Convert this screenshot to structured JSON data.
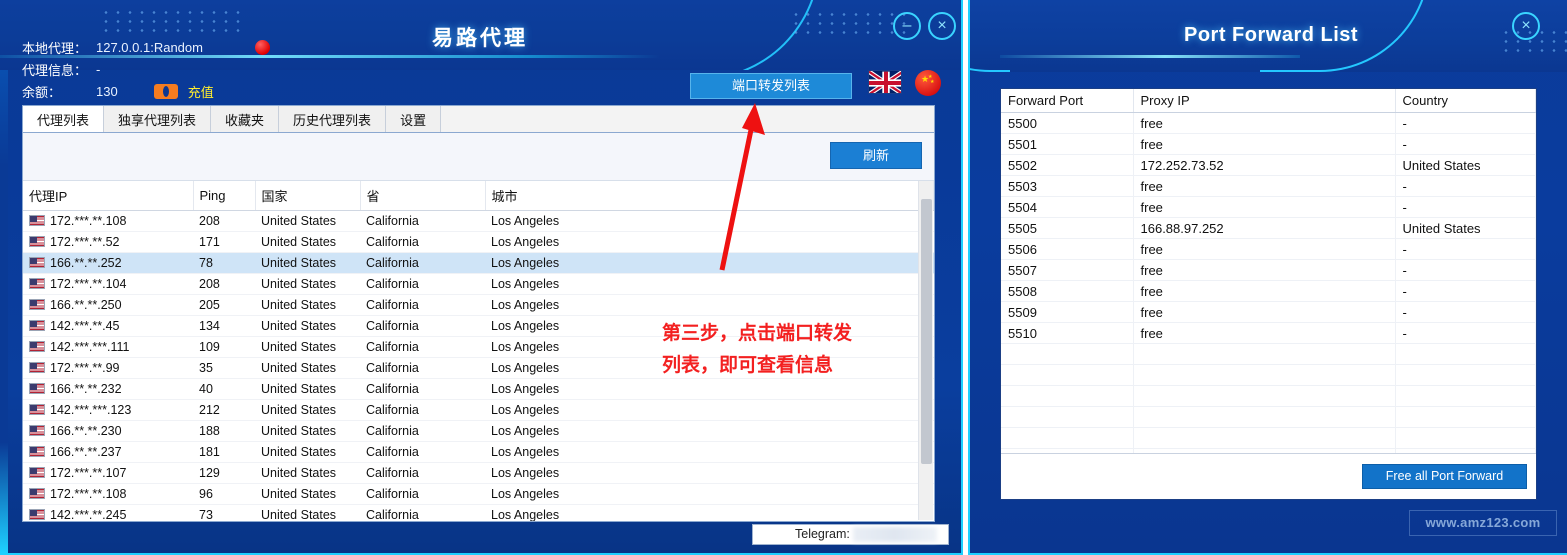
{
  "left_window": {
    "title": "易路代理",
    "controls": {
      "minimize": "–",
      "close": "×"
    },
    "info": {
      "local_proxy_label": "本地代理：",
      "local_proxy_value": "127.0.0.1:Random",
      "proxy_info_label": "代理信息：",
      "proxy_info_value": "-",
      "balance_label": "余额：",
      "balance_value": "130",
      "recharge_label": "充值"
    },
    "port_forward_button": "端口转发列表",
    "flags": {
      "uk": "uk-flag-icon",
      "cn": "cn-flag-icon"
    },
    "tabs": [
      {
        "label": "代理列表",
        "active": true
      },
      {
        "label": "独享代理列表",
        "active": false
      },
      {
        "label": "收藏夹",
        "active": false
      },
      {
        "label": "历史代理列表",
        "active": false
      },
      {
        "label": "设置",
        "active": false
      }
    ],
    "refresh_button": "刷新",
    "table": {
      "columns": [
        "代理IP",
        "Ping",
        "国家",
        "省",
        "城市"
      ],
      "rows": [
        {
          "ip": "172.***.**.108",
          "ping": "208",
          "country": "United States",
          "province": "California",
          "city": "Los Angeles",
          "selected": false
        },
        {
          "ip": "172.***.**.52",
          "ping": "171",
          "country": "United States",
          "province": "California",
          "city": "Los Angeles",
          "selected": false
        },
        {
          "ip": "166.**.**.252",
          "ping": "78",
          "country": "United States",
          "province": "California",
          "city": "Los Angeles",
          "selected": true
        },
        {
          "ip": "172.***.**.104",
          "ping": "208",
          "country": "United States",
          "province": "California",
          "city": "Los Angeles",
          "selected": false
        },
        {
          "ip": "166.**.**.250",
          "ping": "205",
          "country": "United States",
          "province": "California",
          "city": "Los Angeles",
          "selected": false
        },
        {
          "ip": "142.***.**.45",
          "ping": "134",
          "country": "United States",
          "province": "California",
          "city": "Los Angeles",
          "selected": false
        },
        {
          "ip": "142.***.***.111",
          "ping": "109",
          "country": "United States",
          "province": "California",
          "city": "Los Angeles",
          "selected": false
        },
        {
          "ip": "172.***.**.99",
          "ping": "35",
          "country": "United States",
          "province": "California",
          "city": "Los Angeles",
          "selected": false
        },
        {
          "ip": "166.**.**.232",
          "ping": "40",
          "country": "United States",
          "province": "California",
          "city": "Los Angeles",
          "selected": false
        },
        {
          "ip": "142.***.***.123",
          "ping": "212",
          "country": "United States",
          "province": "California",
          "city": "Los Angeles",
          "selected": false
        },
        {
          "ip": "166.**.**.230",
          "ping": "188",
          "country": "United States",
          "province": "California",
          "city": "Los Angeles",
          "selected": false
        },
        {
          "ip": "166.**.**.237",
          "ping": "181",
          "country": "United States",
          "province": "California",
          "city": "Los Angeles",
          "selected": false
        },
        {
          "ip": "172.***.**.107",
          "ping": "129",
          "country": "United States",
          "province": "California",
          "city": "Los Angeles",
          "selected": false
        },
        {
          "ip": "172.***.**.108",
          "ping": "96",
          "country": "United States",
          "province": "California",
          "city": "Los Angeles",
          "selected": false
        },
        {
          "ip": "142.***.**.245",
          "ping": "73",
          "country": "United States",
          "province": "California",
          "city": "Los Angeles",
          "selected": false
        }
      ]
    },
    "footer": {
      "telegram_label": "Telegram:"
    }
  },
  "annotation": {
    "line1": "第三步，点击端口转发",
    "line2": "列表，即可查看信息",
    "color": "#f32020"
  },
  "right_window": {
    "title": "Port Forward List",
    "controls": {
      "close": "×"
    },
    "table": {
      "columns": [
        "Forward Port",
        "Proxy IP",
        "Country"
      ],
      "rows": [
        {
          "port": "5500",
          "proxy_ip": "free",
          "country": "-"
        },
        {
          "port": "5501",
          "proxy_ip": "free",
          "country": "-"
        },
        {
          "port": "5502",
          "proxy_ip": "172.252.73.52",
          "country": "United States"
        },
        {
          "port": "5503",
          "proxy_ip": "free",
          "country": "-"
        },
        {
          "port": "5504",
          "proxy_ip": "free",
          "country": "-"
        },
        {
          "port": "5505",
          "proxy_ip": "166.88.97.252",
          "country": "United States"
        },
        {
          "port": "5506",
          "proxy_ip": "free",
          "country": "-"
        },
        {
          "port": "5507",
          "proxy_ip": "free",
          "country": "-"
        },
        {
          "port": "5508",
          "proxy_ip": "free",
          "country": "-"
        },
        {
          "port": "5509",
          "proxy_ip": "free",
          "country": "-"
        },
        {
          "port": "5510",
          "proxy_ip": "free",
          "country": "-"
        },
        {
          "port": "",
          "proxy_ip": "",
          "country": ""
        },
        {
          "port": "",
          "proxy_ip": "",
          "country": ""
        },
        {
          "port": "",
          "proxy_ip": "",
          "country": ""
        },
        {
          "port": "",
          "proxy_ip": "",
          "country": ""
        },
        {
          "port": "",
          "proxy_ip": "",
          "country": ""
        },
        {
          "port": "",
          "proxy_ip": "",
          "country": ""
        }
      ]
    },
    "free_all_button": "Free all Port Forward"
  },
  "watermark": "www.amz123.com",
  "colors": {
    "window_blue": "#0a3a96",
    "accent_cyan": "#1ed0ff",
    "button_blue": "#1b7fd4",
    "recharge_yellow": "#ffee2e",
    "annotation_red": "#f32020",
    "selected_row": "#cfe4f7"
  }
}
